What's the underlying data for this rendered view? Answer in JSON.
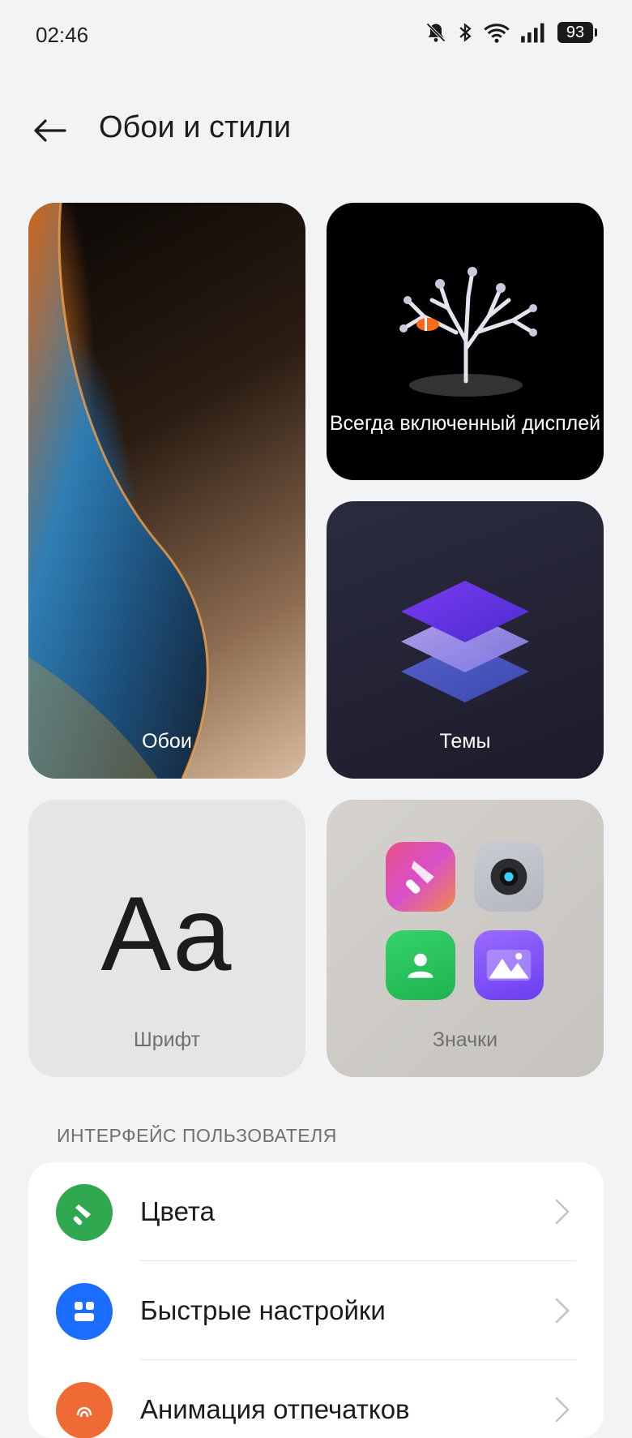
{
  "status_bar": {
    "time": "02:46",
    "battery": "93"
  },
  "header": {
    "title": "Обои и стили"
  },
  "tiles": {
    "wallpaper": "Обои",
    "aod": "Всегда включенный дисплей",
    "themes": "Темы",
    "font": "Шрифт",
    "font_sample": "Aa",
    "icons": "Значки"
  },
  "section": {
    "title": "ИНТЕРФЕЙС ПОЛЬЗОВАТЕЛЯ"
  },
  "settings": {
    "items": [
      {
        "label": "Цвета",
        "icon": "paint-brush-icon",
        "color": "#2fa84f"
      },
      {
        "label": "Быстрые настройки",
        "icon": "quick-settings-icon",
        "color": "#1a6dff"
      },
      {
        "label": "Анимация отпечатков",
        "icon": "fingerprint-icon",
        "color": "#f06a35"
      }
    ]
  },
  "colors": {
    "accent_green": "#2fa84f",
    "accent_blue": "#1a6dff",
    "accent_orange": "#f06a35",
    "background": "#f2f3f5"
  }
}
